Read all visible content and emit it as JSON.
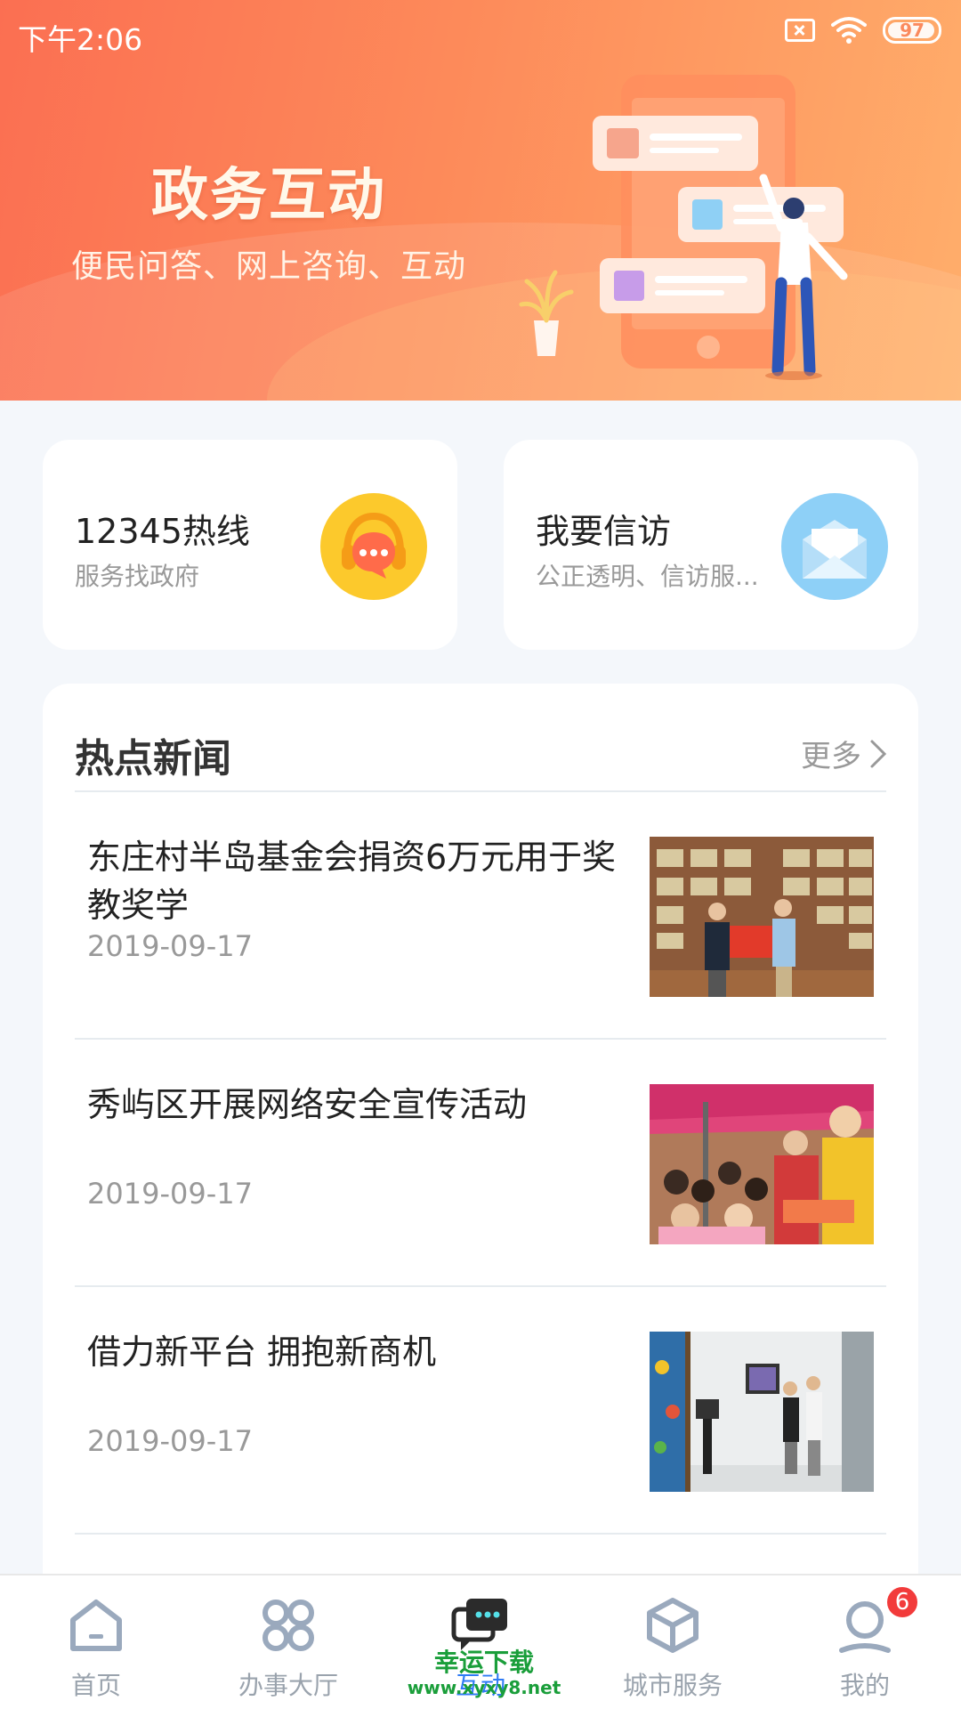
{
  "status_bar": {
    "time": "下午2:06",
    "battery": "97"
  },
  "banner": {
    "title": "政务互动",
    "subtitle": "便民问答、网上咨询、互动"
  },
  "cards": [
    {
      "title": "12345热线",
      "subtitle": "服务找政府",
      "icon": "headset-chat-icon"
    },
    {
      "title": "我要信访",
      "subtitle": "公正透明、信访服...",
      "icon": "envelope-icon"
    }
  ],
  "news": {
    "title": "热点新闻",
    "more_label": "更多",
    "items": [
      {
        "title": "东庄村半岛基金会捐资6万元用于奖教奖学",
        "date": "2019-09-17"
      },
      {
        "title": "秀屿区开展网络安全宣传活动",
        "date": "2019-09-17"
      },
      {
        "title": "借力新平台 拥抱新商机",
        "date": "2019-09-17"
      }
    ]
  },
  "bottom_nav": {
    "items": [
      {
        "label": "首页",
        "icon": "home-icon"
      },
      {
        "label": "办事大厅",
        "icon": "grid-icon"
      },
      {
        "label": "互动",
        "icon": "chat-bubbles-icon",
        "active": true
      },
      {
        "label": "城市服务",
        "icon": "cube-icon"
      },
      {
        "label": "我的",
        "icon": "user-icon",
        "badge": "6"
      }
    ]
  },
  "watermark": {
    "line1": "幸运下载",
    "line2": "www.xyxy8.net"
  },
  "colors": {
    "banner_start": "#fb6f52",
    "banner_end": "#ffae6b",
    "accent": "#2f7bf5",
    "badge": "#f23b3b"
  }
}
